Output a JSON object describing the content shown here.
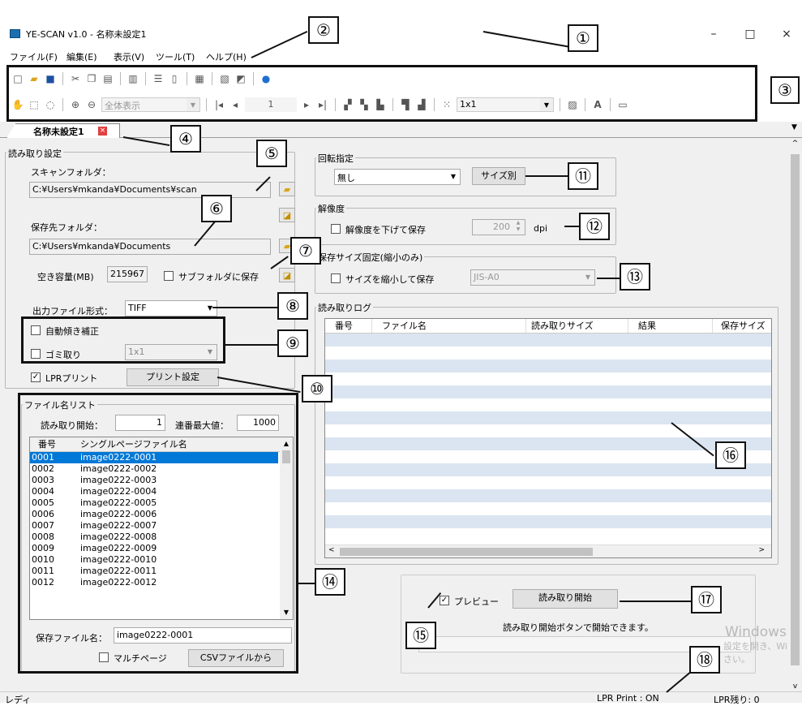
{
  "window": {
    "title": "YE-SCAN v1.0 - 名称未設定1",
    "minimize": "–",
    "maximize": "□",
    "close": "×"
  },
  "menu": [
    "ファイル(F)",
    "編集(E)",
    "表示(V)",
    "ツール(T)",
    "ヘルプ(H)"
  ],
  "toolbar": {
    "zoom": "全体表示",
    "page": "1",
    "scale": "1x1"
  },
  "tab": {
    "label": "名称未設定1"
  },
  "scan": {
    "group": "読み取り設定",
    "scan_folder_label": "スキャンフォルダ：",
    "scan_folder": "C:¥Users¥mkanda¥Documents¥scan",
    "save_folder_label": "保存先フォルダ：",
    "save_folder": "C:¥Users¥mkanda¥Documents",
    "free_label": "空き容量(MB)",
    "free_value": "215967",
    "subfolder": "サブフォルダに保存",
    "format_label": "出力ファイル形式：",
    "format": "TIFF",
    "deskew": "自動傾き補正",
    "dust": "ゴミ取り",
    "dust_value": "1x1",
    "lpr": "LPRプリント",
    "print_btn": "プリント設定"
  },
  "filelist": {
    "group": "ファイル名リスト",
    "start_label": "読み取り開始：",
    "start": "1",
    "max_label": "連番最大値：",
    "max": "1000",
    "col1": "番号",
    "col2": "シングルページファイル名",
    "rows": [
      [
        "0001",
        "image0222-0001"
      ],
      [
        "0002",
        "image0222-0002"
      ],
      [
        "0003",
        "image0222-0003"
      ],
      [
        "0004",
        "image0222-0004"
      ],
      [
        "0005",
        "image0222-0005"
      ],
      [
        "0006",
        "image0222-0006"
      ],
      [
        "0007",
        "image0222-0007"
      ],
      [
        "0008",
        "image0222-0008"
      ],
      [
        "0009",
        "image0222-0009"
      ],
      [
        "0010",
        "image0222-0010"
      ],
      [
        "0011",
        "image0222-0011"
      ],
      [
        "0012",
        "image0222-0012"
      ]
    ],
    "save_name_label": "保存ファイル名：",
    "save_name": "image0222-0001",
    "multipage": "マルチページ",
    "csv_btn": "CSVファイルから"
  },
  "rotation": {
    "group": "回転指定",
    "value": "無し",
    "size_btn": "サイズ別"
  },
  "resolution": {
    "group": "解像度",
    "reduce": "解像度を下げて保存",
    "dpi": "200",
    "unit": "dpi"
  },
  "savesize": {
    "group": "保存サイズ固定(縮小のみ)",
    "shrink": "サイズを縮小して保存",
    "value": "JIS-A0"
  },
  "log": {
    "group": "読み取りログ",
    "cols": [
      "番号",
      "ファイル名",
      "読み取りサイズ",
      "結果",
      "保存サイズ"
    ]
  },
  "start": {
    "preview": "プレビュー",
    "start_btn": "読み取り開始",
    "message": "読み取り開始ボタンで開始できます。"
  },
  "watermark": {
    "line1": "Windows の",
    "line2": "設定を開き、Wi",
    "line3": "さい。"
  },
  "status": {
    "left": "レディ",
    "lpr_print": "LPR Print : ON",
    "lpr_left": "LPR残り: 0"
  },
  "callouts": [
    "①",
    "②",
    "③",
    "④",
    "⑤",
    "⑥",
    "⑦",
    "⑧",
    "⑨",
    "⑩",
    "⑪",
    "⑫",
    "⑬",
    "⑭",
    "⑮",
    "⑯",
    "⑰",
    "⑱"
  ]
}
